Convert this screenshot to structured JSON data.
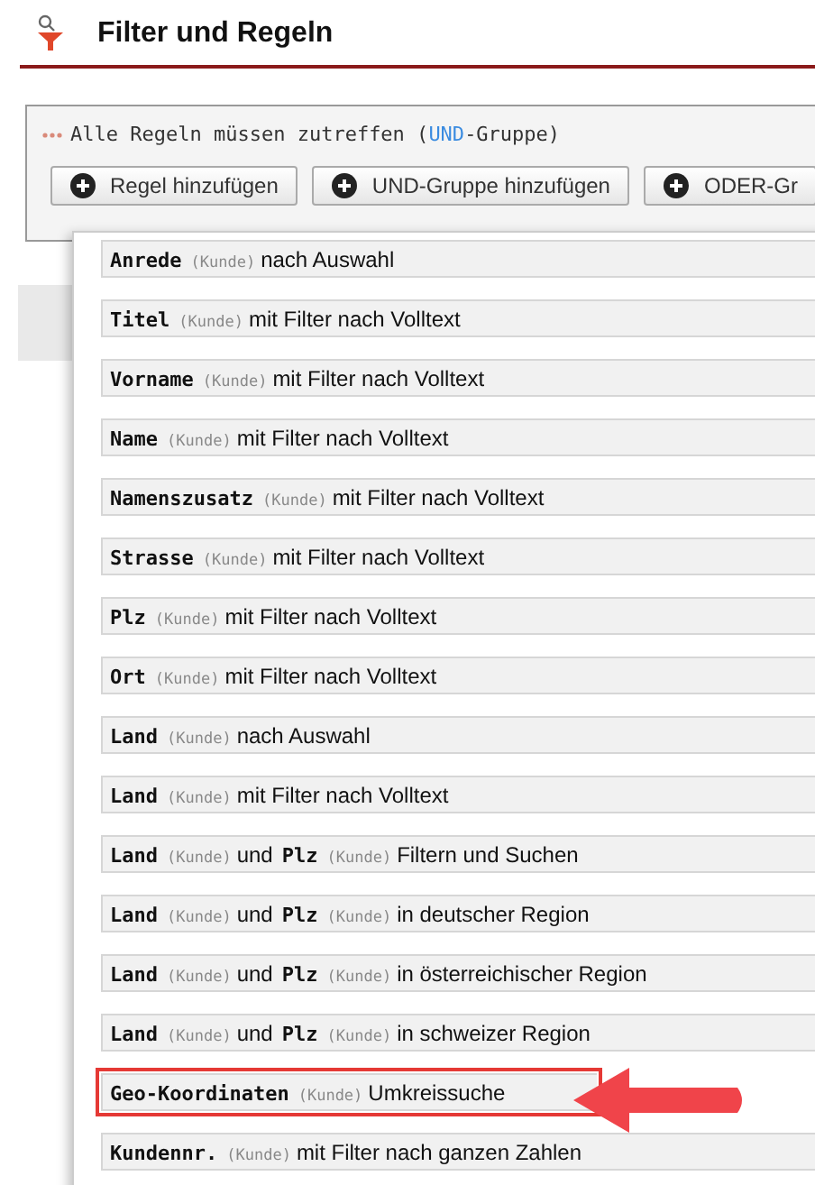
{
  "header": {
    "title": "Filter und Regeln"
  },
  "group": {
    "caption": [
      {
        "kind": "text",
        "text": "Alle Regeln müssen zutreffen ("
      },
      {
        "kind": "keyword",
        "text": "UND"
      },
      {
        "kind": "text",
        "text": "-Gruppe)"
      }
    ],
    "buttons": [
      "Regel hinzufügen",
      "UND-Gruppe hinzufügen",
      "ODER-Gr"
    ]
  },
  "rules": [
    {
      "highlighted": false,
      "parts": [
        {
          "kind": "field",
          "text": "Anrede"
        },
        {
          "kind": "source",
          "text": "(Kunde)"
        },
        {
          "kind": "text",
          "text": "nach Auswahl"
        }
      ]
    },
    {
      "highlighted": false,
      "parts": [
        {
          "kind": "field",
          "text": "Titel"
        },
        {
          "kind": "source",
          "text": "(Kunde)"
        },
        {
          "kind": "text",
          "text": "mit Filter nach Volltext"
        }
      ]
    },
    {
      "highlighted": false,
      "parts": [
        {
          "kind": "field",
          "text": "Vorname"
        },
        {
          "kind": "source",
          "text": "(Kunde)"
        },
        {
          "kind": "text",
          "text": "mit Filter nach Volltext"
        }
      ]
    },
    {
      "highlighted": false,
      "parts": [
        {
          "kind": "field",
          "text": "Name"
        },
        {
          "kind": "source",
          "text": "(Kunde)"
        },
        {
          "kind": "text",
          "text": "mit Filter nach Volltext"
        }
      ]
    },
    {
      "highlighted": false,
      "parts": [
        {
          "kind": "field",
          "text": "Namenszusatz"
        },
        {
          "kind": "source",
          "text": "(Kunde)"
        },
        {
          "kind": "text",
          "text": "mit Filter nach Volltext"
        }
      ]
    },
    {
      "highlighted": false,
      "parts": [
        {
          "kind": "field",
          "text": "Strasse"
        },
        {
          "kind": "source",
          "text": "(Kunde)"
        },
        {
          "kind": "text",
          "text": "mit Filter nach Volltext"
        }
      ]
    },
    {
      "highlighted": false,
      "parts": [
        {
          "kind": "field",
          "text": "Plz"
        },
        {
          "kind": "source",
          "text": "(Kunde)"
        },
        {
          "kind": "text",
          "text": "mit Filter nach Volltext"
        }
      ]
    },
    {
      "highlighted": false,
      "parts": [
        {
          "kind": "field",
          "text": "Ort"
        },
        {
          "kind": "source",
          "text": "(Kunde)"
        },
        {
          "kind": "text",
          "text": "mit Filter nach Volltext"
        }
      ]
    },
    {
      "highlighted": false,
      "parts": [
        {
          "kind": "field",
          "text": "Land"
        },
        {
          "kind": "source",
          "text": "(Kunde)"
        },
        {
          "kind": "text",
          "text": "nach Auswahl"
        }
      ]
    },
    {
      "highlighted": false,
      "parts": [
        {
          "kind": "field",
          "text": "Land"
        },
        {
          "kind": "source",
          "text": "(Kunde)"
        },
        {
          "kind": "text",
          "text": "mit Filter nach Volltext"
        }
      ]
    },
    {
      "highlighted": false,
      "parts": [
        {
          "kind": "field",
          "text": "Land"
        },
        {
          "kind": "source",
          "text": "(Kunde)"
        },
        {
          "kind": "text",
          "text": "und"
        },
        {
          "kind": "field",
          "text": "Plz"
        },
        {
          "kind": "source",
          "text": "(Kunde)"
        },
        {
          "kind": "text",
          "text": "Filtern und Suchen"
        }
      ]
    },
    {
      "highlighted": false,
      "parts": [
        {
          "kind": "field",
          "text": "Land"
        },
        {
          "kind": "source",
          "text": "(Kunde)"
        },
        {
          "kind": "text",
          "text": "und"
        },
        {
          "kind": "field",
          "text": "Plz"
        },
        {
          "kind": "source",
          "text": "(Kunde)"
        },
        {
          "kind": "text",
          "text": "in deutscher Region"
        }
      ]
    },
    {
      "highlighted": false,
      "parts": [
        {
          "kind": "field",
          "text": "Land"
        },
        {
          "kind": "source",
          "text": "(Kunde)"
        },
        {
          "kind": "text",
          "text": "und"
        },
        {
          "kind": "field",
          "text": "Plz"
        },
        {
          "kind": "source",
          "text": "(Kunde)"
        },
        {
          "kind": "text",
          "text": "in österreichischer Region"
        }
      ]
    },
    {
      "highlighted": false,
      "parts": [
        {
          "kind": "field",
          "text": "Land"
        },
        {
          "kind": "source",
          "text": "(Kunde)"
        },
        {
          "kind": "text",
          "text": "und"
        },
        {
          "kind": "field",
          "text": "Plz"
        },
        {
          "kind": "source",
          "text": "(Kunde)"
        },
        {
          "kind": "text",
          "text": "in schweizer Region"
        }
      ]
    },
    {
      "highlighted": true,
      "parts": [
        {
          "kind": "field",
          "text": "Geo-Koordinaten"
        },
        {
          "kind": "source",
          "text": "(Kunde)"
        },
        {
          "kind": "text",
          "text": "Umkreissuche"
        }
      ]
    },
    {
      "highlighted": false,
      "parts": [
        {
          "kind": "field",
          "text": "Kundennr."
        },
        {
          "kind": "source",
          "text": "(Kunde)"
        },
        {
          "kind": "text",
          "text": "mit Filter nach ganzen Zahlen"
        }
      ]
    }
  ]
}
